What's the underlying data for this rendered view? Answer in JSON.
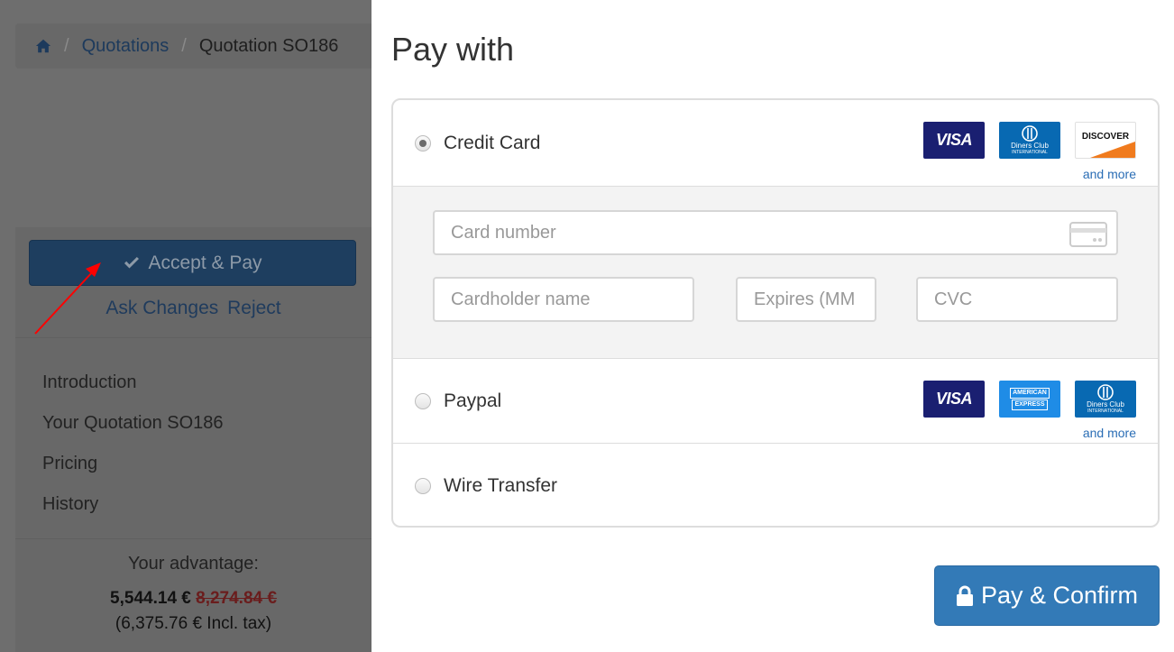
{
  "breadcrumb": {
    "home_icon": "home-icon",
    "items": [
      "Quotations",
      "Quotation SO186"
    ],
    "separator": "/"
  },
  "sidebar": {
    "accept_label": "Accept & Pay",
    "ask_changes_label": "Ask Changes",
    "reject_label": "Reject",
    "toc": [
      "Introduction",
      "Your Quotation SO186",
      "Pricing",
      "History"
    ],
    "advantage_label": "Your advantage:",
    "price_new": "5,544.14 €",
    "price_old": "8,274.84 €",
    "incl_tax": "(6,375.76 € Incl. tax)"
  },
  "modal": {
    "title": "Pay with",
    "methods": [
      {
        "label": "Credit Card",
        "selected": true,
        "logos": [
          "VISA",
          "Diners Club",
          "DISCOVER"
        ],
        "more": "and more"
      },
      {
        "label": "Paypal",
        "selected": false,
        "logos": [
          "VISA",
          "American Express",
          "Diners Club"
        ],
        "more": "and more"
      },
      {
        "label": "Wire Transfer",
        "selected": false
      }
    ],
    "form": {
      "card_number_placeholder": "Card number",
      "cardholder_placeholder": "Cardholder name",
      "expires_placeholder": "Expires (MM",
      "cvc_placeholder": "CVC"
    },
    "confirm_label": "Pay & Confirm"
  },
  "logo_text": {
    "visa": "VISA",
    "diners_line1": "Diners Club",
    "diners_line2": "INTERNATIONAL",
    "discover": "DISCOVER",
    "amex_line1": "AMERICAN",
    "amex_line2": "EXPRESS"
  },
  "colors": {
    "accent": "#337ab7",
    "overlay": "#6e6e6e",
    "link": "#2a6db5",
    "annotation_arrow": "#ff0000"
  }
}
